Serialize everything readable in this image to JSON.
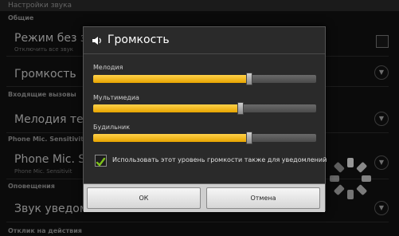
{
  "settings": {
    "title": "Настройки звука",
    "section_general": "Общие",
    "silent_mode": {
      "title": "Режим без зв",
      "subtitle": "Отключить все звук"
    },
    "volume": {
      "title": "Громкость"
    },
    "section_incoming": "Входящие вызовы",
    "ringtone": {
      "title": "Мелодия тел"
    },
    "section_sensitivity": "Phone Mic. Sensitivity",
    "phone_mic": {
      "title": "Phone Mic. Se",
      "subtitle": "Phone Mic. Sensitivit"
    },
    "section_notifications": "Оповещения",
    "notif_sound": {
      "title": "Звук уведомл"
    },
    "section_feedback": "Отклик на действия"
  },
  "dialog": {
    "title": "Громкость",
    "icon": "speaker-icon",
    "sliders": [
      {
        "label": "Мелодия",
        "level": 0.7
      },
      {
        "label": "Мультимедиа",
        "level": 0.66
      },
      {
        "label": "Будильник",
        "level": 0.7
      }
    ],
    "checkbox": {
      "label": "Использовать этот уровень громкости также для уведомлений",
      "checked": true
    },
    "ok_label": "ОК",
    "cancel_label": "Отмена"
  },
  "colors": {
    "accent": "#f2b705",
    "check": "#7fc21b"
  }
}
